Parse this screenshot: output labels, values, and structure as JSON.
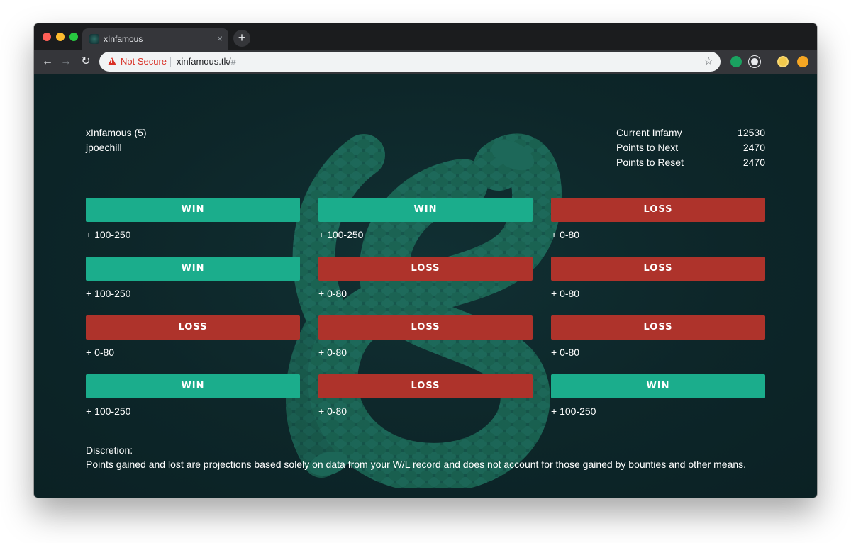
{
  "browser": {
    "tab_title": "xInfamous",
    "tab_close": "×",
    "new_tab": "+",
    "not_secure": "Not Secure",
    "url_host": "xinfamous.tk/",
    "url_path": "#",
    "nav_back": "←",
    "nav_forward": "→",
    "nav_reload": "↻",
    "bookmark": "☆"
  },
  "user": {
    "name": "xInfamous (5)",
    "subtitle": "jpoechill"
  },
  "stats": [
    {
      "label": "Current Infamy",
      "value": "12530"
    },
    {
      "label": "Points to Next",
      "value": "2470"
    },
    {
      "label": "Points to Reset",
      "value": "2470"
    }
  ],
  "results": [
    {
      "label": "WIN",
      "type": "win",
      "range": "+ 100-250"
    },
    {
      "label": "WIN",
      "type": "win",
      "range": "+ 100-250"
    },
    {
      "label": "LOSS",
      "type": "loss",
      "range": "+ 0-80"
    },
    {
      "label": "WIN",
      "type": "win",
      "range": "+ 100-250"
    },
    {
      "label": "LOSS",
      "type": "loss",
      "range": "+ 0-80"
    },
    {
      "label": "LOSS",
      "type": "loss",
      "range": "+ 0-80"
    },
    {
      "label": "LOSS",
      "type": "loss",
      "range": "+ 0-80"
    },
    {
      "label": "LOSS",
      "type": "loss",
      "range": "+ 0-80"
    },
    {
      "label": "LOSS",
      "type": "loss",
      "range": "+ 0-80"
    },
    {
      "label": "WIN",
      "type": "win",
      "range": "+ 100-250"
    },
    {
      "label": "LOSS",
      "type": "loss",
      "range": "+ 0-80"
    },
    {
      "label": "WIN",
      "type": "win",
      "range": "+ 100-250"
    }
  ],
  "discretion": {
    "title": "Discretion:",
    "body": "Points gained and lost are projections based solely on data from your W/L record and does not account for those gained by bounties and other means."
  },
  "colors": {
    "win": "#1bad8c",
    "loss": "#ae332b",
    "background": "#0d2427"
  },
  "icons": [
    "warning-icon",
    "star-icon",
    "snake-logo"
  ]
}
